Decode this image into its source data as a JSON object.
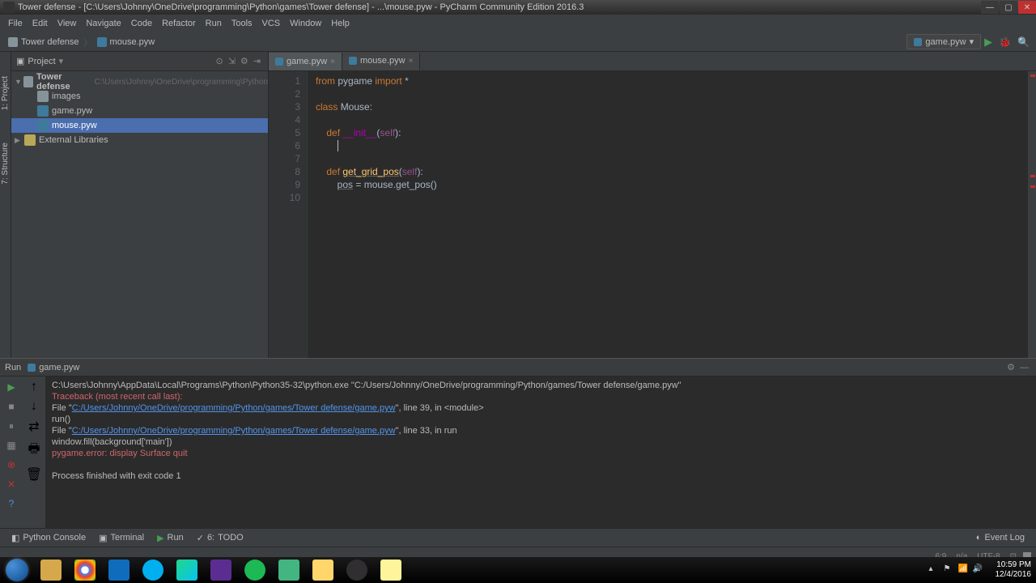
{
  "window": {
    "title": "Tower defense - [C:\\Users\\Johnny\\OneDrive\\programming\\Python\\games\\Tower defense] - ...\\mouse.pyw - PyCharm Community Edition 2016.3"
  },
  "menu": [
    "File",
    "Edit",
    "View",
    "Navigate",
    "Code",
    "Refactor",
    "Run",
    "Tools",
    "VCS",
    "Window",
    "Help"
  ],
  "breadcrumbs": [
    {
      "label": "Tower defense",
      "type": "folder"
    },
    {
      "label": "mouse.pyw",
      "type": "py"
    }
  ],
  "run_config": {
    "name": "game.pyw"
  },
  "project": {
    "header": "Project",
    "root": {
      "label": "Tower defense",
      "path": "C:\\Users\\Johnny\\OneDrive\\programming\\Python"
    },
    "items": [
      {
        "label": "images",
        "type": "folder",
        "level": 1
      },
      {
        "label": "game.pyw",
        "type": "py",
        "level": 1
      },
      {
        "label": "mouse.pyw",
        "type": "py",
        "level": 1,
        "selected": true
      }
    ],
    "external": "External Libraries"
  },
  "tabs": [
    {
      "label": "game.pyw",
      "active": false
    },
    {
      "label": "mouse.pyw",
      "active": true
    }
  ],
  "code": {
    "lines": [
      {
        "n": 1,
        "tokens": [
          {
            "t": "from ",
            "c": "kw"
          },
          {
            "t": "pygame ",
            "c": ""
          },
          {
            "t": "import ",
            "c": "kw"
          },
          {
            "t": "*",
            "c": ""
          }
        ]
      },
      {
        "n": 2,
        "tokens": []
      },
      {
        "n": 3,
        "tokens": [
          {
            "t": "class ",
            "c": "kw"
          },
          {
            "t": "Mouse:",
            "c": ""
          }
        ]
      },
      {
        "n": 4,
        "tokens": []
      },
      {
        "n": 5,
        "tokens": [
          {
            "t": "    ",
            "c": ""
          },
          {
            "t": "def ",
            "c": "kw"
          },
          {
            "t": "__init__",
            "c": "special"
          },
          {
            "t": "(",
            "c": ""
          },
          {
            "t": "self",
            "c": "self"
          },
          {
            "t": "):",
            "c": ""
          }
        ]
      },
      {
        "n": 6,
        "tokens": [
          {
            "t": "        ",
            "c": ""
          }
        ],
        "cursor": true
      },
      {
        "n": 7,
        "tokens": []
      },
      {
        "n": 8,
        "tokens": [
          {
            "t": "    ",
            "c": ""
          },
          {
            "t": "def ",
            "c": "kw"
          },
          {
            "t": "get_grid_pos",
            "c": "fn underline"
          },
          {
            "t": "(",
            "c": ""
          },
          {
            "t": "self",
            "c": "self"
          },
          {
            "t": "):",
            "c": ""
          }
        ]
      },
      {
        "n": 9,
        "tokens": [
          {
            "t": "        ",
            "c": ""
          },
          {
            "t": "pos",
            "c": "underline"
          },
          {
            "t": " = mouse.get_pos()",
            "c": ""
          }
        ]
      },
      {
        "n": 10,
        "tokens": []
      }
    ]
  },
  "run_panel": {
    "header": "Run",
    "config": "game.pyw",
    "output": [
      {
        "text": "C:\\Users\\Johnny\\AppData\\Local\\Programs\\Python\\Python35-32\\python.exe \"C:/Users/Johnny/OneDrive/programming/Python/games/Tower defense/game.pyw\"",
        "class": ""
      },
      {
        "text": "Traceback (most recent call last):",
        "class": "error"
      },
      {
        "prefix": "  File \"",
        "link": "C:/Users/Johnny/OneDrive/programming/Python/games/Tower defense/game.pyw",
        "suffix": "\", line 39, in <module>",
        "class": ""
      },
      {
        "text": "    run()",
        "class": ""
      },
      {
        "prefix": "  File \"",
        "link": "C:/Users/Johnny/OneDrive/programming/Python/games/Tower defense/game.pyw",
        "suffix": "\", line 33, in run",
        "class": ""
      },
      {
        "text": "    window.fill(background['main'])",
        "class": ""
      },
      {
        "text": "pygame.error: display Surface quit",
        "class": "error"
      },
      {
        "text": "",
        "class": ""
      },
      {
        "text": "Process finished with exit code 1",
        "class": ""
      }
    ]
  },
  "bottom_tabs": {
    "python_console": "Python Console",
    "terminal": "Terminal",
    "run": "Run",
    "todo": "TODO",
    "event_log": "Event Log"
  },
  "statusbar": {
    "pos": "6:9",
    "encoding": "UTF-8"
  },
  "taskbar": {
    "time": "10:59 PM",
    "date": "12/4/2016"
  }
}
